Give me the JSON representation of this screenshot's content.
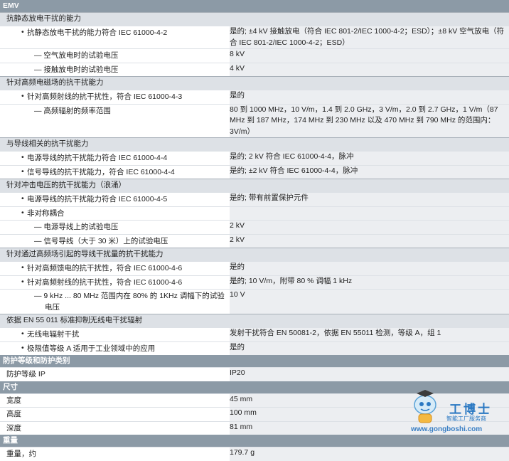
{
  "sections": [
    {
      "title": "EMV",
      "groups": [
        {
          "heading": "抗静态放电干扰的能力",
          "rows": [
            {
              "level": 1,
              "label": "抗静态放电干扰的能力符合 IEC 61000-4-2",
              "value": "是的; ±4 kV 接触放电（符合 IEC 801-2/IEC 1000-4-2；ESD）；±8 kV 空气放电（符合 IEC 801-2/IEC 1000-4-2；ESD）"
            },
            {
              "level": 2,
              "label": "— 空气放电时的试验电压",
              "value": "8 kV"
            },
            {
              "level": 2,
              "label": "— 接触放电时的试验电压",
              "value": "4 kV"
            }
          ]
        },
        {
          "heading": "针对高频电磁场的抗干扰能力",
          "rows": [
            {
              "level": 1,
              "label": "针对高频射线的抗干扰性，符合 IEC 61000-4-3",
              "value": "是的"
            },
            {
              "level": 2,
              "label": "— 高频辐射的频率范围",
              "value": "80 到 1000 MHz，10 V/m，1.4 到 2.0 GHz，3 V/m，2.0 到 2.7 GHz，1 V/m（87 MHz 到 187 MHz，174 MHz 到 230 MHz 以及 470 MHz 到 790 MHz 的范围内：3V/m）"
            }
          ]
        },
        {
          "heading": "与导线相关的抗干扰能力",
          "rows": [
            {
              "level": 1,
              "label": "电源导线的抗干扰能力符合 IEC 61000-4-4",
              "value": "是的; 2 kV 符合 IEC 61000-4-4，脉冲"
            },
            {
              "level": 1,
              "label": "信号导线的抗干扰能力，符合 IEC 61000-4-4",
              "value": "是的; ±2 kV 符合 IEC 61000-4-4，脉冲"
            }
          ]
        },
        {
          "heading": "针对冲击电压的抗干扰能力（浪涌）",
          "rows": [
            {
              "level": 1,
              "label": "电源导线的抗干扰能力符合 IEC 61000-4-5",
              "value": "是的; 带有前置保护元件"
            },
            {
              "level": 1,
              "label": "非对称耦合",
              "value": ""
            },
            {
              "level": 2,
              "label": "— 电源导线上的试验电压",
              "value": "2 kV"
            },
            {
              "level": 2,
              "label": "— 信号导线（大于 30 米）上的试验电压",
              "value": "2 kV"
            }
          ]
        },
        {
          "heading": "针对通过高频场引起的导线干扰量的抗干扰能力",
          "rows": [
            {
              "level": 1,
              "label": "针对高频馈电的抗干扰性，符合 IEC 61000-4-6",
              "value": "是的"
            },
            {
              "level": 1,
              "label": "针对高频射线的抗干扰性，符合 IEC 61000-4-6",
              "value": "是的; 10 V/m，附带 80 % 调幅 1 kHz"
            },
            {
              "level": 2,
              "label": "— 9 kHz ... 80 MHz 范围内在 80% 的 1KHz 调幅下的试验电压",
              "value": "10 V"
            }
          ]
        },
        {
          "heading": "依据 EN 55 011 标准抑制无线电干扰辐射",
          "rows": [
            {
              "level": 1,
              "label": "无线电辐射干扰",
              "value": "发射干扰符合 EN 50081-2，依据 EN 55011 检测，等级 A，组 1"
            },
            {
              "level": 1,
              "label": "极限值等级 A 适用于工业领域中的应用",
              "value": "是的"
            }
          ]
        }
      ]
    },
    {
      "title": "防护等级和防护类别",
      "groups": [
        {
          "heading": "",
          "rows": [
            {
              "level": 0,
              "label": "防护等级 IP",
              "value": "IP20"
            }
          ]
        }
      ]
    },
    {
      "title": "尺寸",
      "groups": [
        {
          "heading": "",
          "rows": [
            {
              "level": 0,
              "label": "宽度",
              "value": "45 mm"
            },
            {
              "level": 0,
              "label": "高度",
              "value": "100 mm"
            },
            {
              "level": 0,
              "label": "深度",
              "value": "81 mm"
            }
          ]
        }
      ]
    },
    {
      "title": "重量",
      "groups": [
        {
          "heading": "",
          "rows": [
            {
              "level": 0,
              "label": "重量，约",
              "value": "179.7 g"
            }
          ]
        }
      ]
    }
  ],
  "watermark": {
    "brand": "工博士",
    "subtitle": "智能工厂服务商",
    "url": "www.gongboshi.com",
    "accent": "#2a78c2"
  }
}
